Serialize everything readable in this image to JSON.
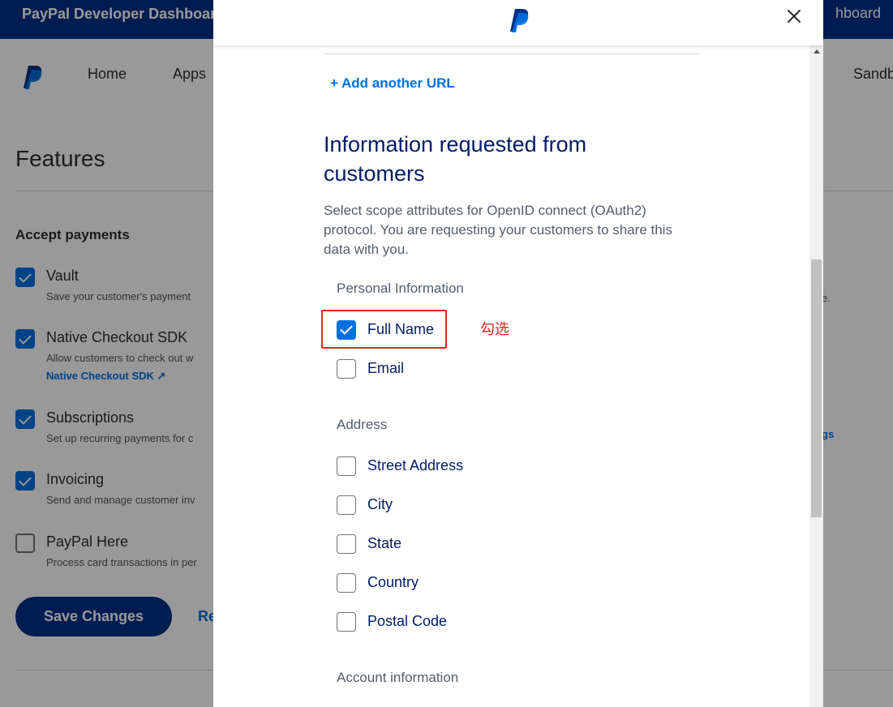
{
  "background": {
    "topbar": {
      "title": "PayPal Developer Dashboard",
      "title_right_fragment": "hboard"
    },
    "nav": {
      "items": [
        "Home",
        "Apps"
      ],
      "right_fragment": "Sandb"
    },
    "page_title": "Features",
    "section_title": "Accept payments",
    "features": [
      {
        "name": "Vault",
        "desc": "Save your customer's payment",
        "checked": true,
        "disabled": true
      },
      {
        "name": "Native Checkout SDK",
        "desc": "Allow customers to check out w",
        "link": "Native Checkout SDK",
        "checked": true,
        "disabled": true
      },
      {
        "name": "Subscriptions",
        "desc": "Set up recurring payments for c",
        "checked": true,
        "disabled": false
      },
      {
        "name": "Invoicing",
        "desc": "Send and manage customer inv",
        "checked": true,
        "disabled": false
      },
      {
        "name": "PayPal Here",
        "desc": "Process card transactions in per",
        "checked": false,
        "disabled": false
      }
    ],
    "save_button": "Save Changes",
    "reset_fragment": "Re",
    "right_fragments": {
      "period": "e.",
      "gs": "gs"
    }
  },
  "modal": {
    "add_url": "+ Add another URL",
    "heading": "Information requested from customers",
    "description": "Select scope attributes for OpenID connect (OAuth2) protocol. You are requesting your customers to share this data with you.",
    "groups": [
      {
        "label": "Personal Information",
        "options": [
          {
            "label": "Full Name",
            "checked": true
          },
          {
            "label": "Email",
            "checked": false
          }
        ]
      },
      {
        "label": "Address",
        "options": [
          {
            "label": "Street Address",
            "checked": false
          },
          {
            "label": "City",
            "checked": false
          },
          {
            "label": "State",
            "checked": false
          },
          {
            "label": "Country",
            "checked": false
          },
          {
            "label": "Postal Code",
            "checked": false
          }
        ]
      },
      {
        "label": "Account information",
        "options": []
      }
    ],
    "annotation": "勾选"
  },
  "colors": {
    "brand_navy": "#003087",
    "accent_blue": "#0070e0",
    "annotation_red": "#e0281e"
  }
}
